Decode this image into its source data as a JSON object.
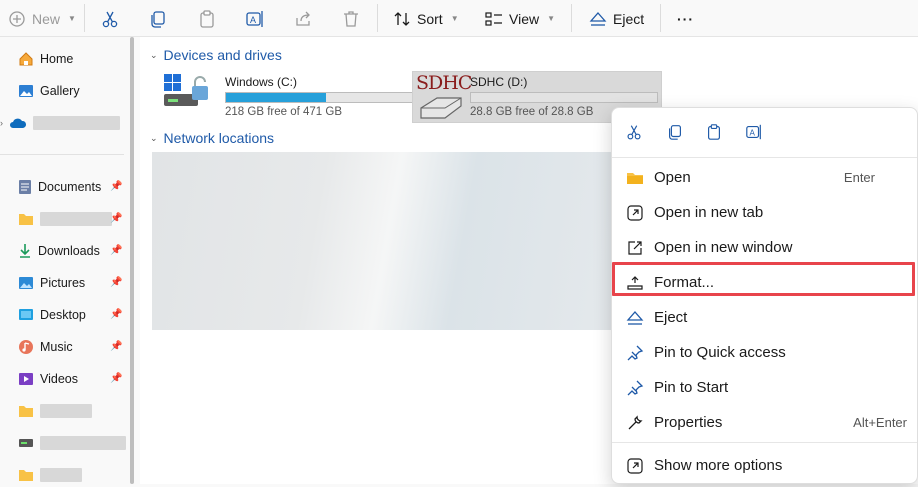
{
  "toolbar": {
    "new_label": "New",
    "sort_label": "Sort",
    "view_label": "View",
    "eject_label": "Eject",
    "more_label": "···"
  },
  "sidebar": {
    "home": "Home",
    "gallery": "Gallery",
    "documents": "Documents",
    "downloads": "Downloads",
    "pictures": "Pictures",
    "desktop": "Desktop",
    "music": "Music",
    "videos": "Videos"
  },
  "main": {
    "devices_header": "Devices and drives",
    "network_header": "Network locations",
    "drives": [
      {
        "name": "Windows (C:)",
        "free_text": "218 GB free of 471 GB",
        "used_fraction": 0.54
      },
      {
        "name": "SDHC (D:)",
        "free_text": "28.8 GB free of 28.8 GB",
        "used_fraction": 0.0,
        "badge": "SDHC"
      }
    ]
  },
  "context_menu": {
    "items": [
      {
        "label": "Open",
        "shortcut": "Enter"
      },
      {
        "label": "Open in new tab",
        "shortcut": ""
      },
      {
        "label": "Open in new window",
        "shortcut": ""
      },
      {
        "label": "Format...",
        "shortcut": ""
      },
      {
        "label": "Eject",
        "shortcut": ""
      },
      {
        "label": "Pin to Quick access",
        "shortcut": ""
      },
      {
        "label": "Pin to Start",
        "shortcut": ""
      },
      {
        "label": "Properties",
        "shortcut": "Alt+Enter"
      },
      {
        "label": "Show more options",
        "shortcut": ""
      }
    ]
  },
  "colors": {
    "accent": "#1f5aa8",
    "progress": "#26a0da",
    "highlight": "#e8444b"
  }
}
